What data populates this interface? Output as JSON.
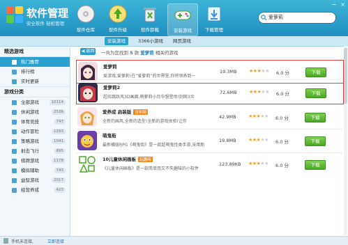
{
  "header": {
    "title": "软件管理",
    "slogan": "安全软件 轻松管理",
    "toolbar": [
      {
        "label": "软件仓库",
        "icon": "software-warehouse-icon"
      },
      {
        "label": "软件升级",
        "icon": "software-upgrade-icon"
      },
      {
        "label": "软件卸载",
        "icon": "software-uninstall-icon"
      },
      {
        "label": "安装游戏",
        "icon": "install-games-icon"
      },
      {
        "label": "下载管理",
        "icon": "download-manager-icon"
      }
    ],
    "search_value": "爱萝莉"
  },
  "subtabs": [
    "安装游戏",
    "3366小游戏",
    "网页游戏"
  ],
  "sidebar": {
    "section1": "精选游戏",
    "items1": [
      {
        "label": "热门推荐",
        "icon": "fire-icon"
      },
      {
        "label": "排行榜",
        "icon": "trophy-icon"
      },
      {
        "label": "实时更新",
        "icon": "clock-icon"
      }
    ],
    "section2": "游戏分类",
    "items2": [
      {
        "label": "全部游戏",
        "count": "10114"
      },
      {
        "label": "休闲游戏",
        "count": "2536"
      },
      {
        "label": "体育竞技",
        "count": "747"
      },
      {
        "label": "动作冒险",
        "count": "1293"
      },
      {
        "label": "策略游戏",
        "count": "1041"
      },
      {
        "label": "射击飞行",
        "count": "895"
      },
      {
        "label": "棋牌游戏",
        "count": "1178"
      },
      {
        "label": "模拟辅助",
        "count": "743"
      },
      {
        "label": "益智游戏",
        "count": "2017"
      },
      {
        "label": "经营养成",
        "count": "423"
      }
    ]
  },
  "main": {
    "back_label": "返回",
    "result_prefix": "一共为您找到",
    "result_count": "5",
    "result_mid": "款",
    "result_keyword": "爱萝莉",
    "result_suffix": "相关的游戏",
    "download_label": "下载",
    "score_unit": "分",
    "apps": [
      {
        "name": "爱萝莉",
        "tag": "",
        "desc": "爱游戏,爱萝莉!在“爱萝莉”的世界里,你将领养到一",
        "size": "19.3MB",
        "stars": 3,
        "score": "6.0"
      },
      {
        "name": "爱萝莉2",
        "tag": "",
        "desc": "超炫跳跃风3D画面,萌萝莉小月华想登场!剑网3众",
        "size": "72.6MB",
        "stars": 3,
        "score": "6.0"
      },
      {
        "name": "爱养成 启装版",
        "tag": "当年网",
        "desc": "全新的画风,全新的造型!全新的游戏体验!让你",
        "size": "42.9MB",
        "stars": 3,
        "score": "6.0"
      },
      {
        "name": "萌鬼街",
        "tag": "",
        "desc": "最新横版RPG《萌鬼街》是一款超萌鬼怪类手游,采用新",
        "size": "19.8MB",
        "stars": 3,
        "score": "6.0"
      },
      {
        "name": "10儿童休闲画板",
        "tag": "玩趣网",
        "desc": "《儿童休闲画板》是一款简单而又不失趣味的小软件",
        "size": "123.89KB",
        "stars": 3,
        "score": "6.0"
      }
    ]
  },
  "status": {
    "text": "手机未连接,",
    "link": "立即连接"
  },
  "colors": {
    "header": "#2a9fd0",
    "accent": "#2aa0d0",
    "download": "#5cb734",
    "highlight_border": "#e04040"
  }
}
